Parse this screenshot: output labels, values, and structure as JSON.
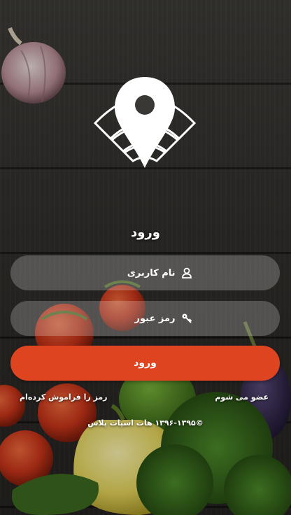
{
  "screen": {
    "title": "ورود"
  },
  "form": {
    "username_placeholder": "نام کاربری",
    "password_placeholder": "رمز عبور",
    "login_label": "ورود"
  },
  "links": {
    "forgot_password": "رمز را فراموش کردەام",
    "signup": "عضو می شوم"
  },
  "footer": {
    "copyright": "©۱۳۹۶-۱۳۹۵ هات اسپات پلاس"
  },
  "icons": {
    "logo": "location-wifi-logo",
    "username": "user-icon",
    "password": "key-icon"
  },
  "colors": {
    "accent": "#df4420",
    "field_background": "rgba(255,255,255,0.22)",
    "text": "#ffffff"
  }
}
